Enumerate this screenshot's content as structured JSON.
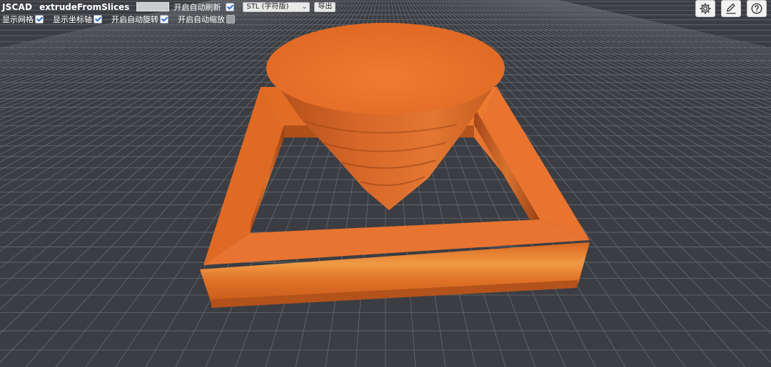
{
  "app": {
    "brand": "JSCAD",
    "design_name": "extrudeFromSlices"
  },
  "toolbar": {
    "auto_refresh_label": "开启自动刷新",
    "auto_refresh": true,
    "format_selected": "STL (字符版)",
    "export_label": "导出"
  },
  "options": {
    "show_grid_label": "显示网格",
    "show_grid": true,
    "show_axes_label": "显示坐标轴",
    "show_axes": true,
    "auto_rotate_label": "开启自动旋转",
    "auto_rotate": true,
    "auto_zoom_label": "开启自动缩放",
    "auto_zoom": false
  },
  "icons": {
    "settings": "gear-icon",
    "edit": "pencil-icon",
    "help": "question-icon"
  },
  "colors": {
    "background": "#3b3d42",
    "grid": "#6c6f74",
    "model": "#e8732c",
    "model_dark": "#b8521a",
    "accent_check": "#2c6fd6"
  }
}
